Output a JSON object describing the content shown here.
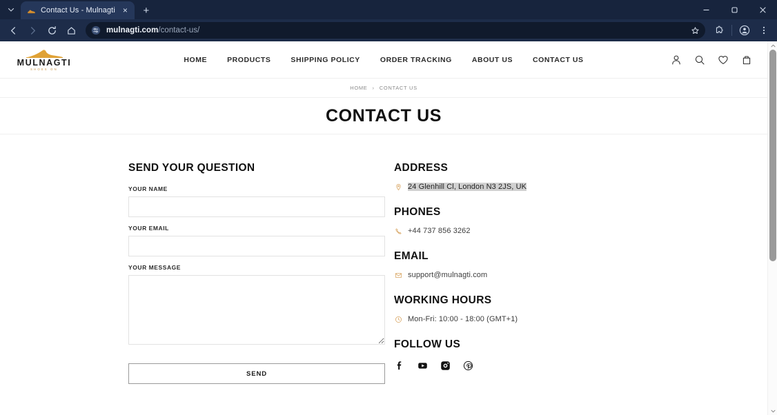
{
  "browser": {
    "tab": {
      "title": "Contact Us - Mulnagti",
      "favicon_name": "shoe-favicon",
      "close_label": "×",
      "new_tab_label": "+"
    },
    "tab_list_chevron": "⌄",
    "window_controls": {
      "minimize": "minimize-icon",
      "maximize": "maximize-icon",
      "close": "close-icon"
    },
    "toolbar": {
      "back": "back-arrow-icon",
      "forward": "forward-arrow-icon",
      "reload": "reload-icon",
      "home": "home-icon",
      "site_info": "site-settings-icon",
      "url_domain": "mulnagti.com",
      "url_path": "/contact-us/",
      "bookmark": "star-icon",
      "extensions": "extensions-puzzle-icon",
      "profile": "profile-avatar-icon",
      "menu": "three-dot-menu-icon"
    }
  },
  "site": {
    "logo": {
      "word": "MULNAGTI",
      "subtitle": "SHOES ON",
      "icon_name": "sneaker-icon",
      "accent_color": "#e0a236"
    },
    "nav": [
      {
        "label": "HOME"
      },
      {
        "label": "PRODUCTS"
      },
      {
        "label": "SHIPPING POLICY"
      },
      {
        "label": "ORDER TRACKING"
      },
      {
        "label": "ABOUT US"
      },
      {
        "label": "CONTACT US"
      }
    ],
    "header_icons": [
      {
        "name": "account-icon"
      },
      {
        "name": "search-icon"
      },
      {
        "name": "wishlist-heart-icon"
      },
      {
        "name": "shopping-bag-icon"
      }
    ],
    "breadcrumb": {
      "home": "HOME",
      "separator": "›",
      "current": "CONTACT US"
    },
    "page_title": "CONTACT US"
  },
  "form": {
    "heading": "SEND YOUR QUESTION",
    "fields": [
      {
        "label": "YOUR NAME",
        "value": "",
        "placeholder": ""
      },
      {
        "label": "YOUR EMAIL",
        "value": "",
        "placeholder": ""
      }
    ],
    "message": {
      "label": "YOUR MESSAGE",
      "value": "",
      "placeholder": ""
    },
    "submit_label": "SEND"
  },
  "info": {
    "address": {
      "heading": "ADDRESS",
      "icon": "map-pin-icon",
      "text": "24 Glenhill Cl, London N3 2JS, UK",
      "selected": true
    },
    "phones": {
      "heading": "PHONES",
      "icon": "phone-icon",
      "text": "+44 737 856 3262"
    },
    "email": {
      "heading": "EMAIL",
      "icon": "envelope-icon",
      "text": "support@mulnagti.com"
    },
    "working_hours": {
      "heading": "WORKING HOURS",
      "icon": "clock-icon",
      "text": "Mon-Fri: 10:00 - 18:00 (GMT+1)"
    },
    "follow": {
      "heading": "FOLLOW US",
      "socials": [
        {
          "name": "facebook-icon"
        },
        {
          "name": "youtube-icon"
        },
        {
          "name": "instagram-icon"
        },
        {
          "name": "pinterest-icon"
        }
      ]
    }
  },
  "colors": {
    "accent": "#d6a05a",
    "chrome_tabstrip": "#17243d",
    "chrome_toolbar": "#1d2c49",
    "selection": "#d0d0d0"
  }
}
